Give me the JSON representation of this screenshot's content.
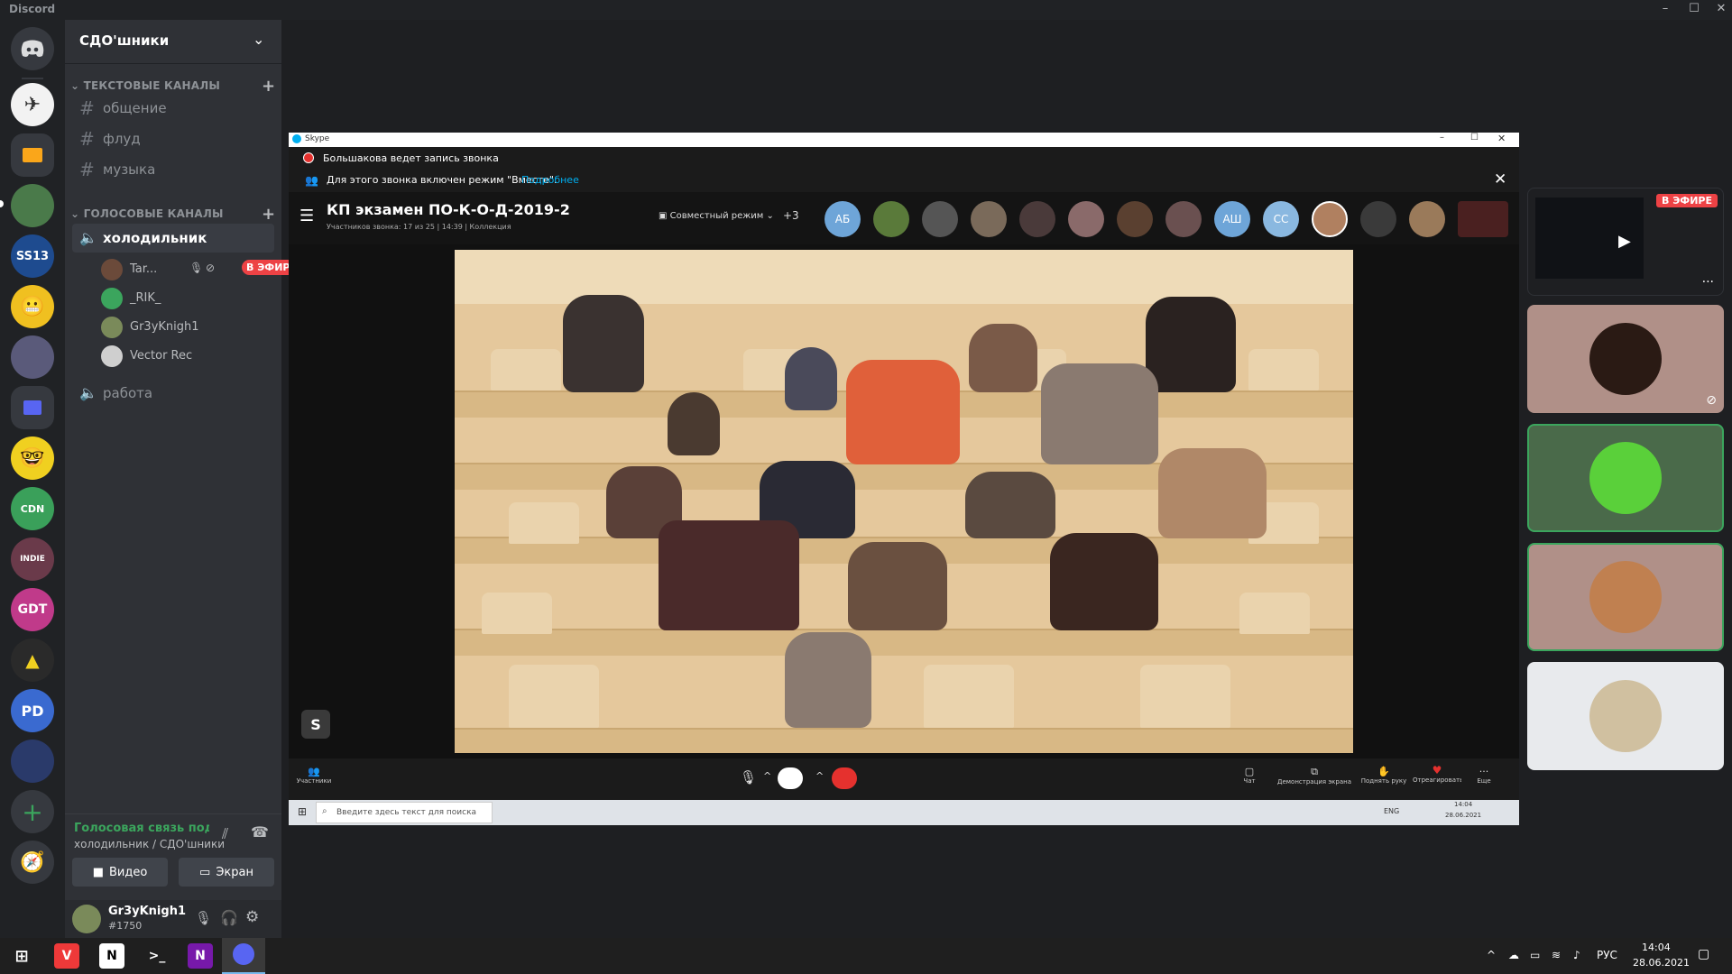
{
  "window": {
    "app_name": "Discord"
  },
  "guild": {
    "name": "СДО'шники"
  },
  "categories": {
    "text": "ТЕКСТОВЫЕ КАНАЛЫ",
    "voice": "ГОЛОСОВЫЕ КАНАЛЫ"
  },
  "text_channels": [
    "общение",
    "флуд",
    "музыка"
  ],
  "voice_channels": {
    "active": "холодильник",
    "other": "работа"
  },
  "voice_users": [
    "Tar...",
    "_RIK_",
    "Gr3yKnigh1",
    "Vector Rec"
  ],
  "live_badge": "В ЭФИРЕ",
  "voice_panel": {
    "status": "Голосовая связь подключена",
    "location": "холодильник / СДО'шники",
    "video": "Видео",
    "screen": "Экран"
  },
  "user": {
    "name": "Gr3yKnigh1",
    "tag": "#1750"
  },
  "skype": {
    "title": "Skype",
    "recording": "Большакова ведет запись звонка",
    "together_prefix": "Для этого звонка включен режим \"Вместе\".",
    "together_link": "Подробнее",
    "call_title": "КП экзамен ПО-К-О-Д-2019-2",
    "call_sub": "Участников звонка: 17 из 25 | 14:39 | Коллекция",
    "mode": "Совместный режим",
    "extra": "+3",
    "initials": [
      "АБ",
      "АШ",
      "СС"
    ],
    "controls": [
      "Участники",
      "Чат",
      "Демонстрация экрана",
      "Поднять руку",
      "Отреагировать",
      "Еще"
    ],
    "search_placeholder": "Введите здесь текст для поиска",
    "inner_tray": {
      "lang": "ENG",
      "time": "14:04",
      "date": "28.06.2021"
    },
    "user_badge": "S"
  },
  "stream_badge": "В ЭФИРЕ",
  "taskbar": {
    "lang": "РУС",
    "time": "14:04",
    "date": "28.06.2021"
  },
  "colors": {
    "live_red": "#ed4245",
    "discord_green": "#3ba55d",
    "skype_blue": "#00aff0",
    "end_call_red": "#e5312e"
  }
}
